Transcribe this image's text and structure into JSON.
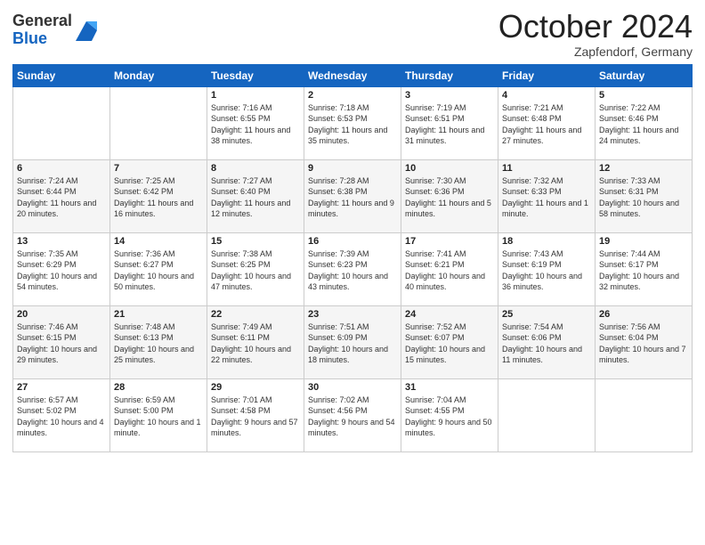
{
  "header": {
    "logo_general": "General",
    "logo_blue": "Blue",
    "month_title": "October 2024",
    "location": "Zapfendorf, Germany"
  },
  "weekdays": [
    "Sunday",
    "Monday",
    "Tuesday",
    "Wednesday",
    "Thursday",
    "Friday",
    "Saturday"
  ],
  "weeks": [
    [
      {
        "day": "",
        "sunrise": "",
        "sunset": "",
        "daylight": ""
      },
      {
        "day": "",
        "sunrise": "",
        "sunset": "",
        "daylight": ""
      },
      {
        "day": "1",
        "sunrise": "Sunrise: 7:16 AM",
        "sunset": "Sunset: 6:55 PM",
        "daylight": "Daylight: 11 hours and 38 minutes."
      },
      {
        "day": "2",
        "sunrise": "Sunrise: 7:18 AM",
        "sunset": "Sunset: 6:53 PM",
        "daylight": "Daylight: 11 hours and 35 minutes."
      },
      {
        "day": "3",
        "sunrise": "Sunrise: 7:19 AM",
        "sunset": "Sunset: 6:51 PM",
        "daylight": "Daylight: 11 hours and 31 minutes."
      },
      {
        "day": "4",
        "sunrise": "Sunrise: 7:21 AM",
        "sunset": "Sunset: 6:48 PM",
        "daylight": "Daylight: 11 hours and 27 minutes."
      },
      {
        "day": "5",
        "sunrise": "Sunrise: 7:22 AM",
        "sunset": "Sunset: 6:46 PM",
        "daylight": "Daylight: 11 hours and 24 minutes."
      }
    ],
    [
      {
        "day": "6",
        "sunrise": "Sunrise: 7:24 AM",
        "sunset": "Sunset: 6:44 PM",
        "daylight": "Daylight: 11 hours and 20 minutes."
      },
      {
        "day": "7",
        "sunrise": "Sunrise: 7:25 AM",
        "sunset": "Sunset: 6:42 PM",
        "daylight": "Daylight: 11 hours and 16 minutes."
      },
      {
        "day": "8",
        "sunrise": "Sunrise: 7:27 AM",
        "sunset": "Sunset: 6:40 PM",
        "daylight": "Daylight: 11 hours and 12 minutes."
      },
      {
        "day": "9",
        "sunrise": "Sunrise: 7:28 AM",
        "sunset": "Sunset: 6:38 PM",
        "daylight": "Daylight: 11 hours and 9 minutes."
      },
      {
        "day": "10",
        "sunrise": "Sunrise: 7:30 AM",
        "sunset": "Sunset: 6:36 PM",
        "daylight": "Daylight: 11 hours and 5 minutes."
      },
      {
        "day": "11",
        "sunrise": "Sunrise: 7:32 AM",
        "sunset": "Sunset: 6:33 PM",
        "daylight": "Daylight: 11 hours and 1 minute."
      },
      {
        "day": "12",
        "sunrise": "Sunrise: 7:33 AM",
        "sunset": "Sunset: 6:31 PM",
        "daylight": "Daylight: 10 hours and 58 minutes."
      }
    ],
    [
      {
        "day": "13",
        "sunrise": "Sunrise: 7:35 AM",
        "sunset": "Sunset: 6:29 PM",
        "daylight": "Daylight: 10 hours and 54 minutes."
      },
      {
        "day": "14",
        "sunrise": "Sunrise: 7:36 AM",
        "sunset": "Sunset: 6:27 PM",
        "daylight": "Daylight: 10 hours and 50 minutes."
      },
      {
        "day": "15",
        "sunrise": "Sunrise: 7:38 AM",
        "sunset": "Sunset: 6:25 PM",
        "daylight": "Daylight: 10 hours and 47 minutes."
      },
      {
        "day": "16",
        "sunrise": "Sunrise: 7:39 AM",
        "sunset": "Sunset: 6:23 PM",
        "daylight": "Daylight: 10 hours and 43 minutes."
      },
      {
        "day": "17",
        "sunrise": "Sunrise: 7:41 AM",
        "sunset": "Sunset: 6:21 PM",
        "daylight": "Daylight: 10 hours and 40 minutes."
      },
      {
        "day": "18",
        "sunrise": "Sunrise: 7:43 AM",
        "sunset": "Sunset: 6:19 PM",
        "daylight": "Daylight: 10 hours and 36 minutes."
      },
      {
        "day": "19",
        "sunrise": "Sunrise: 7:44 AM",
        "sunset": "Sunset: 6:17 PM",
        "daylight": "Daylight: 10 hours and 32 minutes."
      }
    ],
    [
      {
        "day": "20",
        "sunrise": "Sunrise: 7:46 AM",
        "sunset": "Sunset: 6:15 PM",
        "daylight": "Daylight: 10 hours and 29 minutes."
      },
      {
        "day": "21",
        "sunrise": "Sunrise: 7:48 AM",
        "sunset": "Sunset: 6:13 PM",
        "daylight": "Daylight: 10 hours and 25 minutes."
      },
      {
        "day": "22",
        "sunrise": "Sunrise: 7:49 AM",
        "sunset": "Sunset: 6:11 PM",
        "daylight": "Daylight: 10 hours and 22 minutes."
      },
      {
        "day": "23",
        "sunrise": "Sunrise: 7:51 AM",
        "sunset": "Sunset: 6:09 PM",
        "daylight": "Daylight: 10 hours and 18 minutes."
      },
      {
        "day": "24",
        "sunrise": "Sunrise: 7:52 AM",
        "sunset": "Sunset: 6:07 PM",
        "daylight": "Daylight: 10 hours and 15 minutes."
      },
      {
        "day": "25",
        "sunrise": "Sunrise: 7:54 AM",
        "sunset": "Sunset: 6:06 PM",
        "daylight": "Daylight: 10 hours and 11 minutes."
      },
      {
        "day": "26",
        "sunrise": "Sunrise: 7:56 AM",
        "sunset": "Sunset: 6:04 PM",
        "daylight": "Daylight: 10 hours and 7 minutes."
      }
    ],
    [
      {
        "day": "27",
        "sunrise": "Sunrise: 6:57 AM",
        "sunset": "Sunset: 5:02 PM",
        "daylight": "Daylight: 10 hours and 4 minutes."
      },
      {
        "day": "28",
        "sunrise": "Sunrise: 6:59 AM",
        "sunset": "Sunset: 5:00 PM",
        "daylight": "Daylight: 10 hours and 1 minute."
      },
      {
        "day": "29",
        "sunrise": "Sunrise: 7:01 AM",
        "sunset": "Sunset: 4:58 PM",
        "daylight": "Daylight: 9 hours and 57 minutes."
      },
      {
        "day": "30",
        "sunrise": "Sunrise: 7:02 AM",
        "sunset": "Sunset: 4:56 PM",
        "daylight": "Daylight: 9 hours and 54 minutes."
      },
      {
        "day": "31",
        "sunrise": "Sunrise: 7:04 AM",
        "sunset": "Sunset: 4:55 PM",
        "daylight": "Daylight: 9 hours and 50 minutes."
      },
      {
        "day": "",
        "sunrise": "",
        "sunset": "",
        "daylight": ""
      },
      {
        "day": "",
        "sunrise": "",
        "sunset": "",
        "daylight": ""
      }
    ]
  ]
}
